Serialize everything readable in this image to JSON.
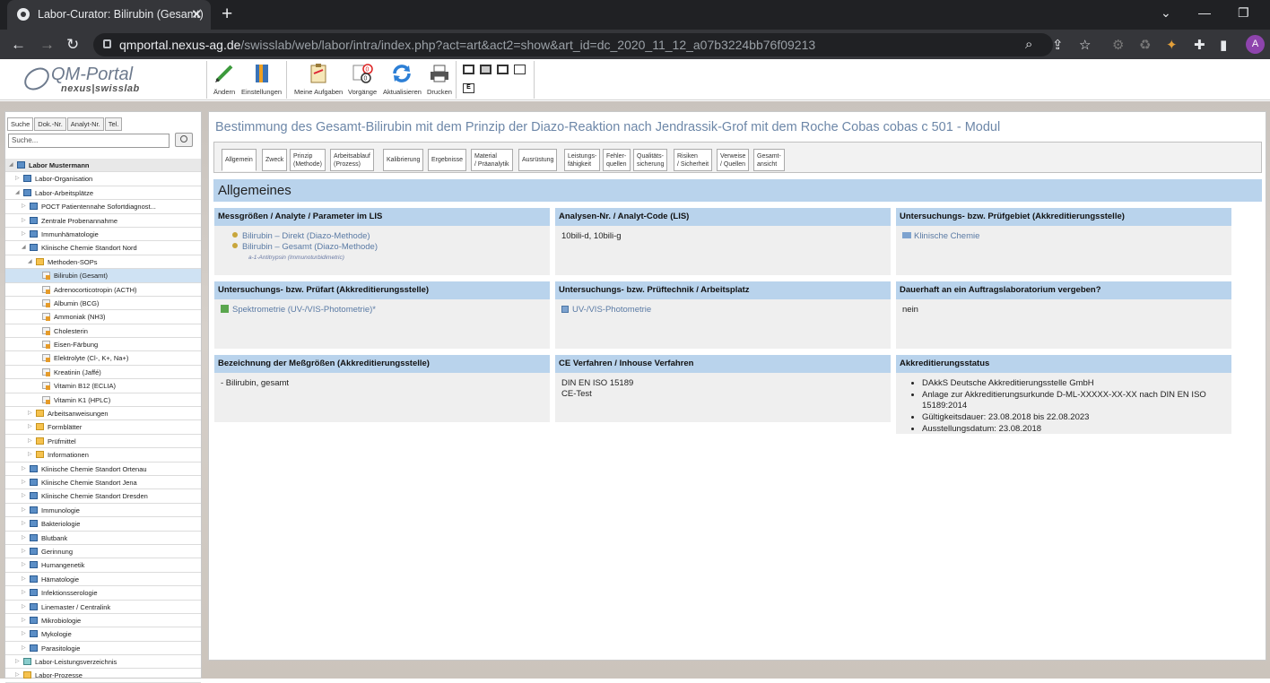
{
  "browser": {
    "tab_title": "Labor-Curator: Bilirubin (Gesamt)",
    "url_domain": "qmportal.nexus-ag.de",
    "url_path": "/swisslab/web/labor/intra/index.php?act=art&act2=show&art_id=dc_2020_11_12_a07b3224bb76f09213",
    "avatar_letter": "A"
  },
  "app": {
    "logo_title": "QM-Portal",
    "logo_sub": "nexus|swisslab",
    "toolbar": [
      {
        "label": "Ändern"
      },
      {
        "label": "Einstellungen"
      },
      {
        "label": "Meine Aufgaben"
      },
      {
        "label": "Vorgänge"
      },
      {
        "label": "Aktualisieren"
      },
      {
        "label": "Drucken"
      }
    ],
    "layout_e": "E",
    "badge_top": "0",
    "badge_bottom": "0"
  },
  "sidebar": {
    "tabs": [
      "Suche",
      "Dok.-Nr.",
      "Analyt-Nr.",
      "Tel."
    ],
    "search_placeholder": "Suche...",
    "tree": [
      {
        "label": "Labor Mustermann",
        "level": 0,
        "icon": "net",
        "arrow": "◢",
        "root": true
      },
      {
        "label": "Labor-Organisation",
        "level": 1,
        "icon": "net",
        "arrow": "▷"
      },
      {
        "label": "Labor-Arbeitsplätze",
        "level": 1,
        "icon": "net",
        "arrow": "◢"
      },
      {
        "label": "POCT Patientennahe Sofortdiagnost...",
        "level": 2,
        "icon": "net",
        "arrow": "▷"
      },
      {
        "label": "Zentrale Probenannahme",
        "level": 2,
        "icon": "net",
        "arrow": "▷"
      },
      {
        "label": "Immunhämatologie",
        "level": 2,
        "icon": "net",
        "arrow": "▷"
      },
      {
        "label": "Klinische Chemie Standort Nord",
        "level": 2,
        "icon": "net",
        "arrow": "◢"
      },
      {
        "label": "Methoden-SOPs",
        "level": 3,
        "icon": "fold",
        "arrow": "◢"
      },
      {
        "label": "Bilirubin (Gesamt)",
        "level": 4,
        "icon": "doc",
        "sel": true
      },
      {
        "label": "Adrenocorticotropin (ACTH)",
        "level": 4,
        "icon": "doc"
      },
      {
        "label": "Albumin (BCG)",
        "level": 4,
        "icon": "doc"
      },
      {
        "label": "Ammoniak (NH3)",
        "level": 4,
        "icon": "doc"
      },
      {
        "label": "Cholesterin",
        "level": 4,
        "icon": "doc"
      },
      {
        "label": "Eisen-Färbung",
        "level": 4,
        "icon": "doc"
      },
      {
        "label": "Elektrolyte (Cl-, K+, Na+)",
        "level": 4,
        "icon": "doc"
      },
      {
        "label": "Kreatinin (Jaffé)",
        "level": 4,
        "icon": "doc"
      },
      {
        "label": "Vitamin B12 (ECLIA)",
        "level": 4,
        "icon": "doc"
      },
      {
        "label": "Vitamin K1 (HPLC)",
        "level": 4,
        "icon": "doc"
      },
      {
        "label": "Arbeitsanweisungen",
        "level": 3,
        "icon": "fold",
        "arrow": "▷"
      },
      {
        "label": "Formblätter",
        "level": 3,
        "icon": "fold",
        "arrow": "▷"
      },
      {
        "label": "Prüfmittel",
        "level": 3,
        "icon": "fold",
        "arrow": "▷"
      },
      {
        "label": "Informationen",
        "level": 3,
        "icon": "fold",
        "arrow": "▷"
      },
      {
        "label": "Klinische Chemie Standort Ortenau",
        "level": 2,
        "icon": "net",
        "arrow": "▷"
      },
      {
        "label": "Klinische Chemie Standort Jena",
        "level": 2,
        "icon": "net",
        "arrow": "▷"
      },
      {
        "label": "Klinische Chemie Standort Dresden",
        "level": 2,
        "icon": "net",
        "arrow": "▷"
      },
      {
        "label": "Immunologie",
        "level": 2,
        "icon": "net",
        "arrow": "▷"
      },
      {
        "label": "Bakteriologie",
        "level": 2,
        "icon": "net",
        "arrow": "▷"
      },
      {
        "label": "Blutbank",
        "level": 2,
        "icon": "net",
        "arrow": "▷"
      },
      {
        "label": "Gerinnung",
        "level": 2,
        "icon": "net",
        "arrow": "▷"
      },
      {
        "label": "Humangenetik",
        "level": 2,
        "icon": "net",
        "arrow": "▷"
      },
      {
        "label": "Hämatologie",
        "level": 2,
        "icon": "net",
        "arrow": "▷"
      },
      {
        "label": "Infektionsserologie",
        "level": 2,
        "icon": "net",
        "arrow": "▷"
      },
      {
        "label": "Linemaster / Centralink",
        "level": 2,
        "icon": "net",
        "arrow": "▷"
      },
      {
        "label": "Mikrobiologie",
        "level": 2,
        "icon": "net",
        "arrow": "▷"
      },
      {
        "label": "Mykologie",
        "level": 2,
        "icon": "net",
        "arrow": "▷"
      },
      {
        "label": "Parasitologie",
        "level": 2,
        "icon": "net",
        "arrow": "▷"
      },
      {
        "label": "Labor-Leistungsverzeichnis",
        "level": 1,
        "icon": "pr",
        "arrow": "▷"
      },
      {
        "label": "Labor-Prozesse",
        "level": 1,
        "icon": "fold",
        "arrow": "▷"
      }
    ]
  },
  "main": {
    "title": "Bestimmung des Gesamt-Bilirubin mit dem Prinzip der Diazo-Reaktion nach Jendrassik-Grof mit dem Roche Cobas cobas c 501 - Modul",
    "tabs": [
      {
        "l1": "Allgemein",
        "l2": ""
      },
      {
        "l1": "Zweck",
        "l2": ""
      },
      {
        "l1": "Prinzip",
        "l2": "(Methode)"
      },
      {
        "l1": "Arbeitsablauf",
        "l2": "(Prozess)"
      },
      {
        "l1": "Kalibrierung",
        "l2": ""
      },
      {
        "l1": "Ergebnisse",
        "l2": ""
      },
      {
        "l1": "Material",
        "l2": "/ Präanalytik"
      },
      {
        "l1": "Ausrüstung",
        "l2": ""
      },
      {
        "l1": "Leistungs-",
        "l2": "fähigkeit"
      },
      {
        "l1": "Fehler-",
        "l2": "quellen"
      },
      {
        "l1": "Qualitäts-",
        "l2": "sicherung"
      },
      {
        "l1": "Risiken",
        "l2": "/ Sicherheit"
      },
      {
        "l1": "Verweise",
        "l2": "/ Quellen"
      },
      {
        "l1": "Gesamt-",
        "l2": "ansicht"
      }
    ],
    "section": "Allgemeines",
    "boxes": {
      "messgroessen": {
        "header": "Messgrößen / Analyte / Parameter im LIS",
        "item1": "Bilirubin – Direkt (Diazo-Methode)",
        "item2": "Bilirubin – Gesamt (Diazo-Methode)",
        "small": "a-1-Antitrypsin (Immunoturbidimetric)"
      },
      "analysen": {
        "header": "Analysen-Nr. / Analyt-Code (LIS)",
        "value": "10bili-d, 10bili-g"
      },
      "pruefgebiet": {
        "header": "Untersuchungs- bzw. Prüfgebiet (Akkreditierungsstelle)",
        "value": "Klinische Chemie"
      },
      "pruefart": {
        "header": "Untersuchungs- bzw. Prüfart (Akkreditierungsstelle)",
        "value": "Spektrometrie (UV-/VIS-Photometrie)*"
      },
      "prueftechnik": {
        "header": "Untersuchungs- bzw. Prüftechnik / Arbeitsplatz",
        "value": "UV-/VIS-Photometrie"
      },
      "auftrag": {
        "header": "Dauerhaft an ein Auftragslaboratorium vergeben?",
        "value": "nein"
      },
      "bezeichnung": {
        "header": "Bezeichnung der Meßgrößen (Akkreditierungsstelle)",
        "value": "- Bilirubin, gesamt"
      },
      "ce": {
        "header": "CE Verfahren / Inhouse Verfahren",
        "line1": "DIN EN ISO 15189",
        "line2": "CE-Test"
      },
      "akkreditierung": {
        "header": "Akkreditierungsstatus",
        "items": [
          "DAkkS Deutsche Akkreditierungsstelle GmbH",
          "Anlage zur Akkreditierungsurkunde D-ML-XXXXX-XX-XX nach DIN EN ISO 15189:2014",
          "Gültigkeitsdauer: 23.08.2018 bis 22.08.2023",
          "Ausstellungsdatum: 23.08.2018"
        ]
      }
    }
  }
}
